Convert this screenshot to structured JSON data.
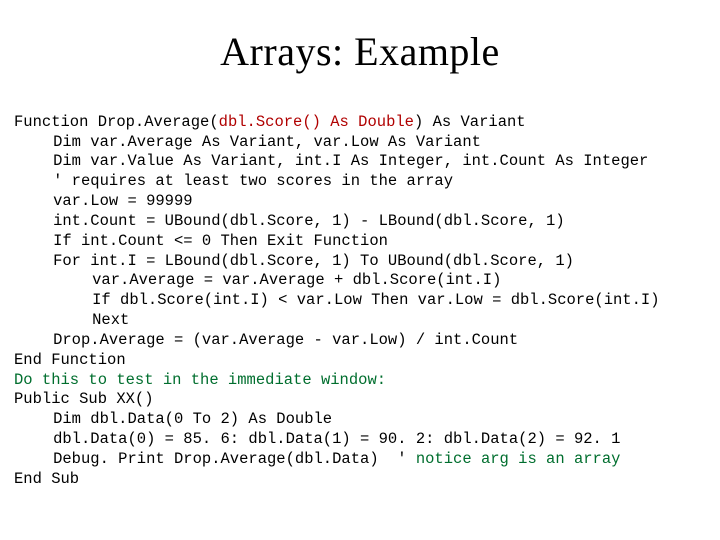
{
  "title": "Arrays: Example",
  "code": {
    "l01a": "Function Drop.Average(",
    "l01b": "dbl.Score() As Double",
    "l01c": ") As Variant",
    "l02": "Dim var.Average As Variant, var.Low As Variant",
    "l03": "Dim var.Value As Variant, int.I As Integer, int.Count As Integer",
    "l04": "' requires at least two scores in the array",
    "l05": "var.Low = 99999",
    "l06": "int.Count = UBound(dbl.Score, 1) - LBound(dbl.Score, 1)",
    "l07": "If int.Count <= 0 Then Exit Function",
    "l08": "For int.I = LBound(dbl.Score, 1) To UBound(dbl.Score, 1)",
    "l09": "var.Average = var.Average + dbl.Score(int.I)",
    "l10": "If dbl.Score(int.I) < var.Low Then var.Low = dbl.Score(int.I)",
    "l11": "Next",
    "l12": "Drop.Average = (var.Average - var.Low) / int.Count",
    "l13": "End Function",
    "l14": "Do this to test in the immediate window:",
    "l15": "Public Sub XX()",
    "l16": "Dim dbl.Data(0 To 2) As Double",
    "l17": "dbl.Data(0) = 85. 6: dbl.Data(1) = 90. 2: dbl.Data(2) = 92. 1",
    "l18a": "Debug. Print Drop.Average(dbl.Data)  ' ",
    "l18b": "notice arg is an array",
    "l19": "End Sub"
  }
}
